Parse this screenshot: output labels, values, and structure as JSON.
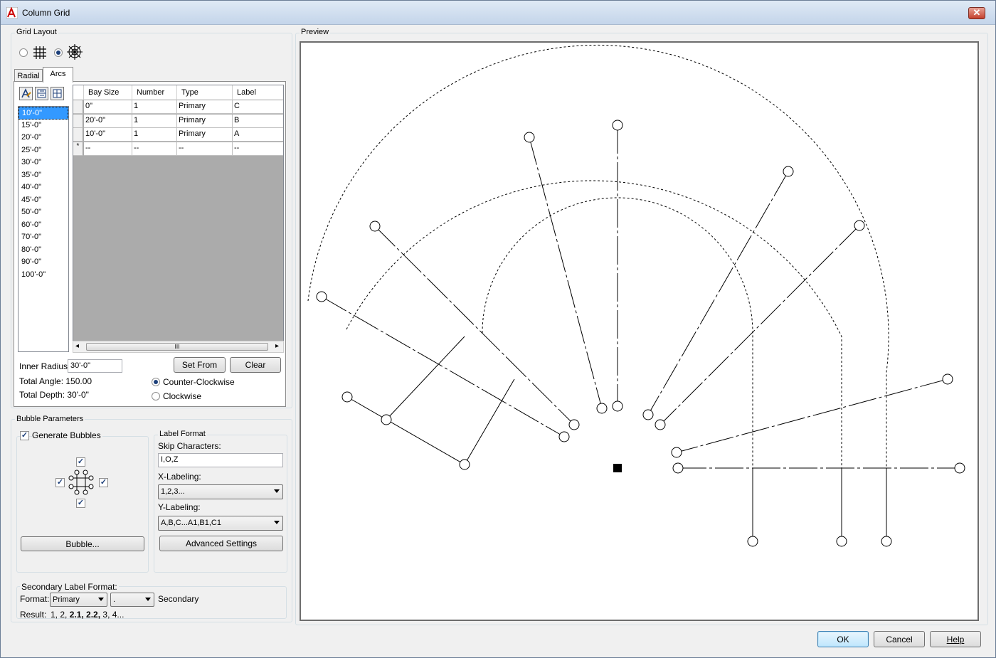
{
  "window": {
    "title": "Column Grid",
    "close_symbol": "✕"
  },
  "grid_layout": {
    "group_label": "Grid Layout",
    "layout_options": [
      {
        "icon": "rectangular-grid-icon",
        "selected": false
      },
      {
        "icon": "radial-grid-icon",
        "selected": true
      }
    ],
    "tabs": [
      {
        "label": "Radial",
        "active": false
      },
      {
        "label": "Arcs",
        "active": true
      }
    ],
    "toolbar_icons": [
      "auto-fill-icon",
      "insert-row-icon",
      "delete-row-icon"
    ],
    "bay_sizes": [
      "10'-0\"",
      "15'-0\"",
      "20'-0\"",
      "25'-0\"",
      "30'-0\"",
      "35'-0\"",
      "40'-0\"",
      "45'-0\"",
      "50'-0\"",
      "60'-0\"",
      "70'-0\"",
      "80'-0\"",
      "90'-0\"",
      "100'-0\""
    ],
    "selected_bay_size": "10'-0\"",
    "table": {
      "headers": [
        "Bay Size",
        "Number",
        "Type",
        "Label"
      ],
      "rows": [
        [
          "0\"",
          "1",
          "Primary",
          "C"
        ],
        [
          "20'-0\"",
          "1",
          "Primary",
          "B"
        ],
        [
          "10'-0\"",
          "1",
          "Primary",
          "A"
        ]
      ],
      "new_row_marker": "*",
      "new_row": [
        "--",
        "--",
        "--",
        "--"
      ],
      "scroll_grip": "III",
      "scroll_left": "◂",
      "scroll_right": "▸"
    },
    "inner_radius_label": "Inner Radius:",
    "inner_radius_value": "30'-0\"",
    "set_from_label": "Set From",
    "clear_label": "Clear",
    "total_angle": "Total Angle: 150.00",
    "total_depth": "Total Depth: 30'-0\"",
    "direction": {
      "ccw_label": "Counter-Clockwise",
      "cw_label": "Clockwise",
      "selected": "ccw"
    }
  },
  "bubble_parameters": {
    "group_label": "Bubble Parameters",
    "generate_bubbles_label": "Generate Bubbles",
    "generate_bubbles_checked": true,
    "sides_checked": {
      "top": true,
      "left": true,
      "right": true,
      "bottom": true
    },
    "check_mark": "✓",
    "bubble_button_label": "Bubble..."
  },
  "label_format": {
    "group_label": "Label Format",
    "skip_characters_label": "Skip Characters:",
    "skip_characters_value": "I,O,Z",
    "x_labeling_label": "X-Labeling:",
    "x_labeling_value": "1,2,3...",
    "y_labeling_label": "Y-Labeling:",
    "y_labeling_value": "A,B,C...A1,B1,C1",
    "advanced_settings_label": "Advanced Settings"
  },
  "secondary_label_format": {
    "group_label": "Secondary Label Format:",
    "format_label": "Format:",
    "format_value": "Primary",
    "separator_value": ".",
    "secondary_label": "Secondary",
    "result_label": "Result:",
    "result_prefix": "1, 2, ",
    "result_bold": "2.1, 2.2,",
    "result_suffix": " 3, 4..."
  },
  "preview": {
    "group_label": "Preview"
  },
  "buttons": {
    "ok": "OK",
    "cancel": "Cancel",
    "help": "Help"
  },
  "colors": {
    "title_bar": "#c4d5ea",
    "selection": "#3399ff",
    "close": "#c4402e"
  }
}
